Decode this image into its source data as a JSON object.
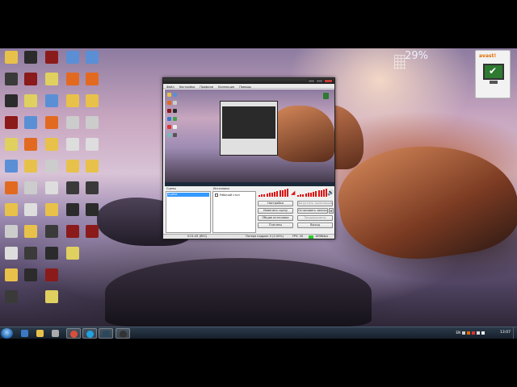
{
  "gadget": {
    "percent": "29%"
  },
  "avast": {
    "brand": "avast!"
  },
  "desktop_icons": [
    {
      "label": "",
      "color": "#e8c14a"
    },
    {
      "label": "",
      "color": "#3a3a3a"
    },
    {
      "label": "",
      "color": "#2b2b2b"
    },
    {
      "label": "",
      "color": "#8b1a1a"
    },
    {
      "label": "",
      "color": "#e0d060"
    },
    {
      "label": "",
      "color": "#5a8fd6"
    },
    {
      "label": "",
      "color": "#e26a20"
    },
    {
      "label": "",
      "color": "#e8c14a"
    },
    {
      "label": "",
      "color": "#cccccc"
    },
    {
      "label": "",
      "color": "#dddddd"
    }
  ],
  "obs": {
    "title": "",
    "menu": [
      "Файл",
      "Настройки",
      "Профили",
      "Коллекция",
      "Помощь"
    ],
    "scenes_label": "Сцены",
    "scene_selected": "Сцена",
    "sources_label": "Источники",
    "source_item": "Рабочий стол",
    "buttons": {
      "settings": "Настройки",
      "start_stream": "Запустить трансляцию",
      "edit_scene": "Изменить сцену",
      "start_record": "Остановить запись",
      "global_sources": "Общие источники",
      "preview": "Предпросмотр",
      "plugins": "Плагины",
      "exit": "Выход"
    },
    "status": {
      "time": "0:01:45 (REC)",
      "dropped": "Потеря кадров: 0 (0.00%)",
      "fps": "FPS: 30",
      "bitrate": "1898kb/s"
    }
  },
  "taskbar": {
    "tray_lang": "EN",
    "clock": "13:07"
  }
}
